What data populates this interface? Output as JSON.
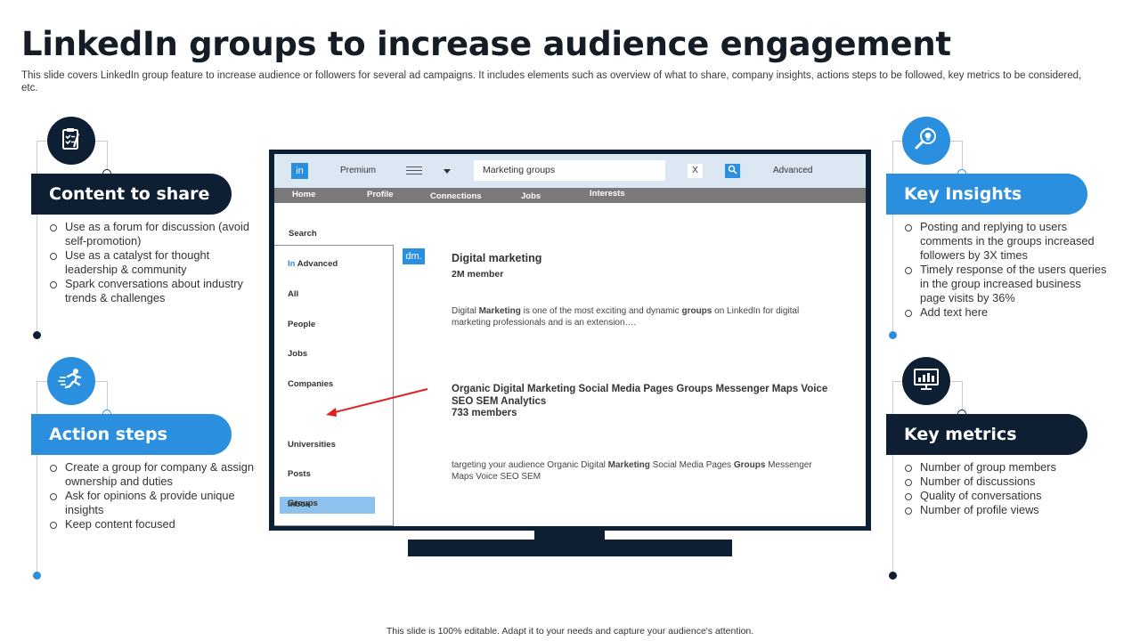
{
  "slide": {
    "title": "LinkedIn groups to increase audience engagement",
    "subtitle": "This slide covers LinkedIn group feature to increase audience or followers for several ad campaigns. It includes elements such as overview of what to share, company insights, actions steps to be followed, key metrics to be considered, etc.",
    "footer": "This slide is 100% editable. Adapt it to your needs and capture your audience's attention."
  },
  "colors": {
    "dark": "#0f1f33",
    "blue": "#2b8fdf",
    "gray_nav": "#7a7a7a",
    "topbar": "#dbe7f3",
    "highlight": "#8dc2ee",
    "arrow": "#e02020"
  },
  "sections": {
    "content_to_share": {
      "heading": "Content to share",
      "icon": "clipboard-checklist-icon",
      "bullets": [
        "Use as a forum for discussion (avoid  self-promotion)",
        "Use as a catalyst for thought leadership & community",
        "Spark conversations  about industry trends & challenges"
      ]
    },
    "action_steps": {
      "heading": "Action steps",
      "icon": "running-person-icon",
      "bullets": [
        "Create a group for company & assign ownership and duties",
        "Ask for opinions & provide unique insights",
        "Keep content focused"
      ]
    },
    "key_insights": {
      "heading": "Key Insights",
      "icon": "lightbulb-search-icon",
      "bullets": [
        "Posting and replying to users comments in the groups increased followers  by 3X times",
        "Timely response of the users queries in the group increased business page visits by 36%",
        "Add text here"
      ]
    },
    "key_metrics": {
      "heading": "Key metrics",
      "icon": "monitor-chart-icon",
      "bullets": [
        "Number of group members",
        "Number of discussions",
        "Quality of conversations",
        "Number of profile views"
      ]
    }
  },
  "mockup": {
    "logo": "in",
    "premium": "Premium",
    "search_value": "Marketing groups",
    "clear": "X",
    "advanced": "Advanced",
    "nav": [
      "Home",
      "Profile",
      "Connections",
      "Jobs",
      "Interests"
    ],
    "search_label": "Search",
    "side_prefix": "In",
    "side_items": [
      "Advanced",
      "All",
      "People",
      "Jobs",
      "Companies",
      "Groups",
      "Universities",
      "Posts",
      "Inbox"
    ],
    "selected_item": "Groups",
    "badge": "dm.",
    "result1": {
      "title": "Digital  marketing",
      "members": "2M member",
      "desc_parts": [
        "Digital ",
        "Marketing",
        " is one of the most exciting and dynamic ",
        "groups",
        " on LinkedIn for digital marketing professionals and is an extension…."
      ]
    },
    "result2": {
      "title": "Organic Digital Marketing Social Media Pages Groups Messenger Maps Voice SEO  SEM Analytics",
      "members": "733 members",
      "desc_parts": [
        "targeting your audience Organic Digital ",
        "Marketing",
        " Social Media Pages ",
        "Groups",
        " Messenger Maps Voice SEO  SEM"
      ]
    }
  }
}
